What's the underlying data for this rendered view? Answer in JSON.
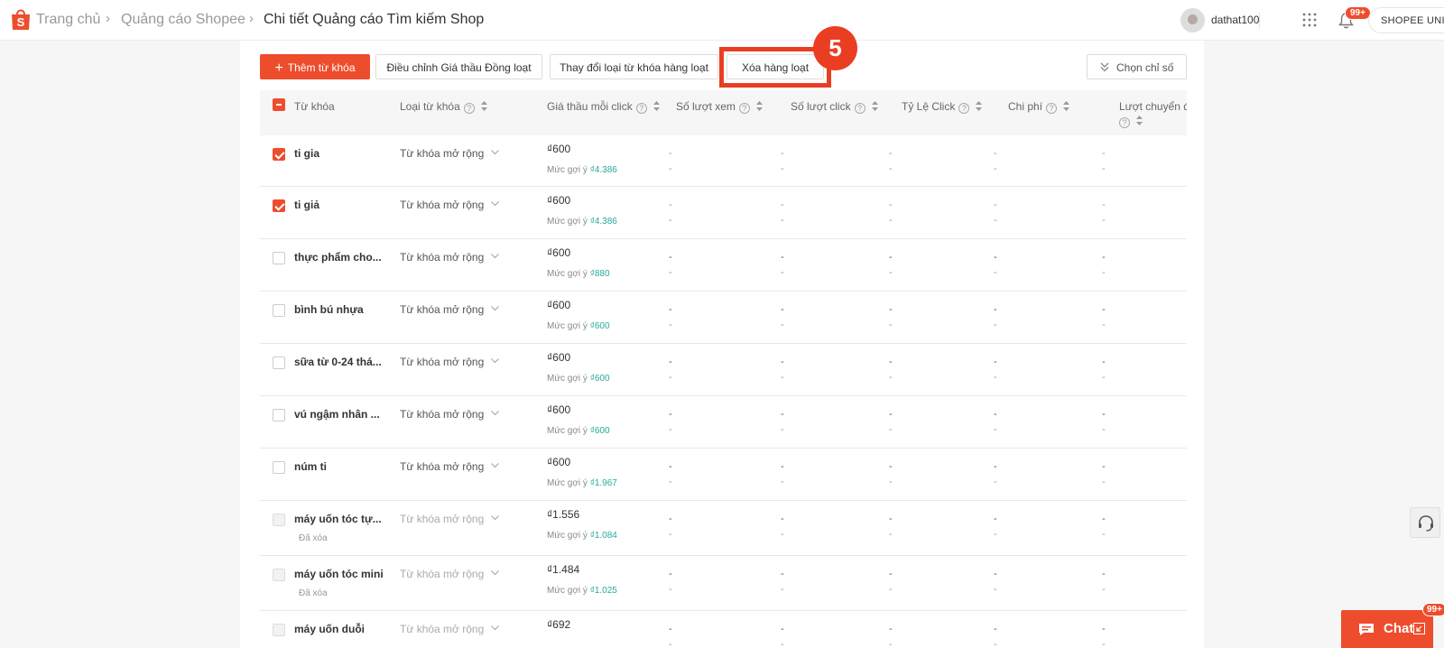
{
  "header": {
    "breadcrumb": [
      "Trang chủ",
      "Quảng cáo Shopee",
      "Chi tiết Quảng cáo Tìm kiếm Shop"
    ],
    "username": "dathat100",
    "notif_count": "99+",
    "uni_label": "SHOPEE UNI"
  },
  "toolbar": {
    "add_keyword": "Thêm từ khóa",
    "adjust_bid": "Điều chỉnh Giá thầu Đồng loạt",
    "change_type": "Thay đổi loại từ khóa hàng loạt",
    "bulk_delete": "Xóa hàng loạt",
    "choose_metrics": "Chọn chỉ số",
    "step_number": "5"
  },
  "table": {
    "columns": {
      "keyword": "Từ khóa",
      "type": "Loại từ khóa",
      "bid": "Giá thầu mỗi click",
      "views": "Số lượt xem",
      "clicks": "Số lượt click",
      "ctr": "Tỷ Lệ Click",
      "cost": "Chi phí",
      "conversions": "Lượt chuyển đổ"
    },
    "suggest_label": "Mức gợi ý",
    "dash": "-",
    "rows": [
      {
        "keyword": "ti gia",
        "type": "Từ khóa mở rộng",
        "bid": "₫600",
        "suggest": "₫4.386",
        "state": "checked",
        "deleted": ""
      },
      {
        "keyword": "ti giả",
        "type": "Từ khóa mở rộng",
        "bid": "₫600",
        "suggest": "₫4.386",
        "state": "checked",
        "deleted": ""
      },
      {
        "keyword": "thực phẩm cho...",
        "type": "Từ khóa mở rộng",
        "bid": "₫600",
        "suggest": "₫880",
        "state": "unchecked",
        "deleted": ""
      },
      {
        "keyword": "bình bú nhựa",
        "type": "Từ khóa mở rộng",
        "bid": "₫600",
        "suggest": "₫600",
        "state": "unchecked",
        "deleted": ""
      },
      {
        "keyword": "sữa từ 0-24 thá...",
        "type": "Từ khóa mở rộng",
        "bid": "₫600",
        "suggest": "₫600",
        "state": "unchecked",
        "deleted": ""
      },
      {
        "keyword": "vú ngậm nhân ...",
        "type": "Từ khóa mở rộng",
        "bid": "₫600",
        "suggest": "₫600",
        "state": "unchecked",
        "deleted": ""
      },
      {
        "keyword": "núm ti",
        "type": "Từ khóa mở rộng",
        "bid": "₫600",
        "suggest": "₫1.967",
        "state": "unchecked",
        "deleted": ""
      },
      {
        "keyword": "máy uốn tóc tự...",
        "type": "Từ khóa mở rộng",
        "bid": "₫1.556",
        "suggest": "₫1.084",
        "state": "disabled",
        "deleted": "Đã xóa"
      },
      {
        "keyword": "máy uốn tóc mini",
        "type": "Từ khóa mở rộng",
        "bid": "₫1.484",
        "suggest": "₫1.025",
        "state": "disabled",
        "deleted": "Đã xóa"
      },
      {
        "keyword": "máy uốn duỗi",
        "type": "Từ khóa mở rộng",
        "bid": "₫692",
        "suggest": "",
        "state": "disabled",
        "deleted": ""
      }
    ]
  },
  "chat": {
    "label": "Chat",
    "badge": "99+"
  }
}
